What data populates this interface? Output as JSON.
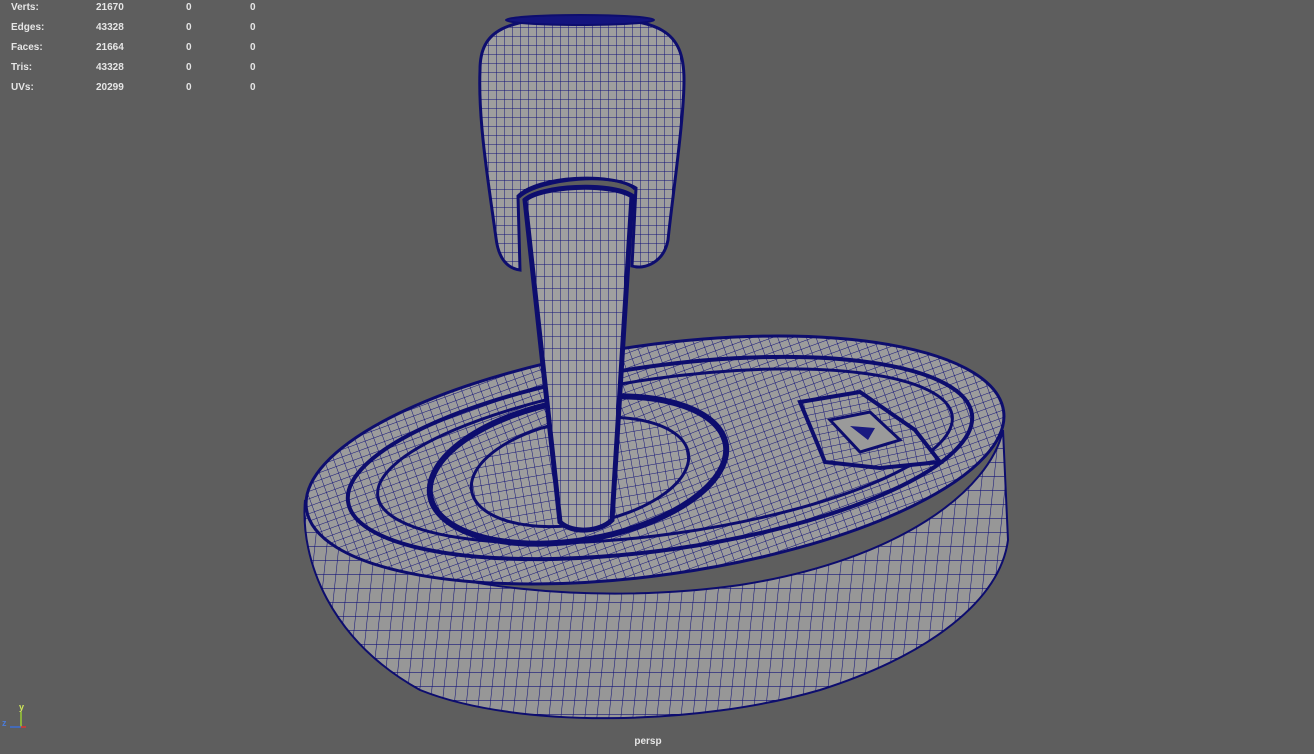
{
  "stats": {
    "rows": [
      {
        "label": "Verts:",
        "total": "21670",
        "selected": "0",
        "component": "0"
      },
      {
        "label": "Edges:",
        "total": "43328",
        "selected": "0",
        "component": "0"
      },
      {
        "label": "Faces:",
        "total": "21664",
        "selected": "0",
        "component": "0"
      },
      {
        "label": "Tris:",
        "total": "43328",
        "selected": "0",
        "component": "0"
      },
      {
        "label": "UVs:",
        "total": "20299",
        "selected": "0",
        "component": "0"
      }
    ]
  },
  "viewport": {
    "camera_name": "persp",
    "background_color": "#5e5e5e",
    "wire_color": "#10107a",
    "surface_color": "#9a9a9a"
  },
  "axis_gizmo": {
    "y_label": "y",
    "z_label": "z",
    "icon": "axis-gizmo-icon"
  }
}
